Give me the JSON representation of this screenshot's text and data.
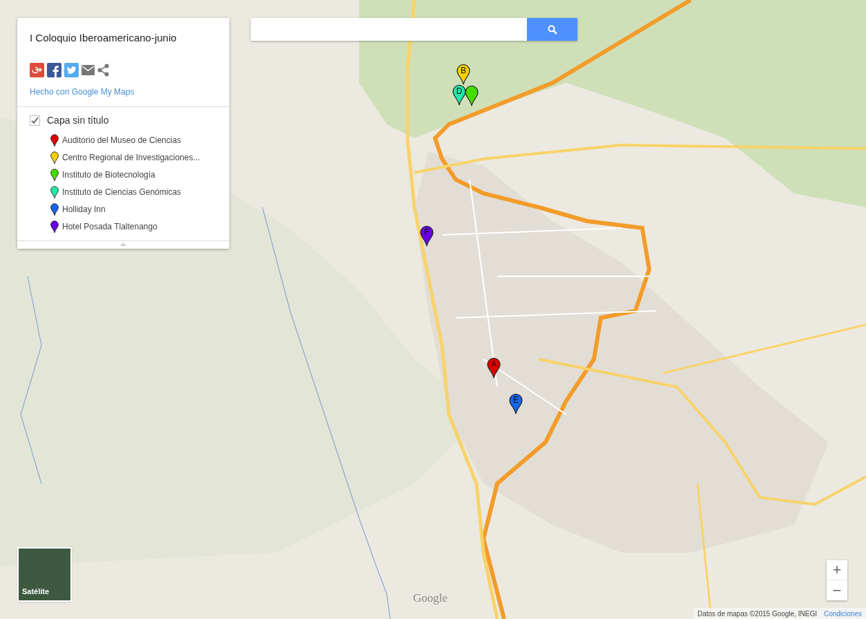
{
  "panel": {
    "title": "I Coloquio Iberoamericano-junio",
    "share_icons": [
      {
        "kind": "gplus",
        "color": "#dd4b39"
      },
      {
        "kind": "facebook",
        "color": "#3b5998"
      },
      {
        "kind": "twitter",
        "color": "#55acee"
      },
      {
        "kind": "email",
        "color": "#777777"
      },
      {
        "kind": "share",
        "color": "#777777"
      }
    ],
    "credit_link": "Hecho con Google My Maps",
    "layer": {
      "name": "Capa sin título",
      "checked": true,
      "items": [
        {
          "label": "Auditorio del Museo de Ciencias",
          "color": "#e00000"
        },
        {
          "label": "Centro Regional de Investigaciones...",
          "color": "#f5d000"
        },
        {
          "label": "Instituto de Biotecnología",
          "color": "#44dd00"
        },
        {
          "label": "Instituto de Ciencias Genómicas",
          "color": "#22e8a8"
        },
        {
          "label": "Holliday Inn",
          "color": "#1565e8"
        },
        {
          "label": "Hotel Posada Tlaltenango",
          "color": "#6a00e8"
        }
      ]
    }
  },
  "map_pins": [
    {
      "letter": "B",
      "color": "#f5d000"
    },
    {
      "color": "#44dd00"
    },
    {
      "letter": "D",
      "color": "#22e8a8"
    },
    {
      "letter": "A",
      "color": "#e00000"
    },
    {
      "letter": "E",
      "color": "#1565e8"
    },
    {
      "letter": "F",
      "color": "#6a00e8"
    }
  ],
  "map": {
    "satellite_toggle": "Satélite",
    "zoom_in": "+",
    "zoom_out": "−",
    "logo": "Google",
    "attribution": "Datos de mapas ©2015 Google, INEGI",
    "terms_link": "Condiciones"
  }
}
